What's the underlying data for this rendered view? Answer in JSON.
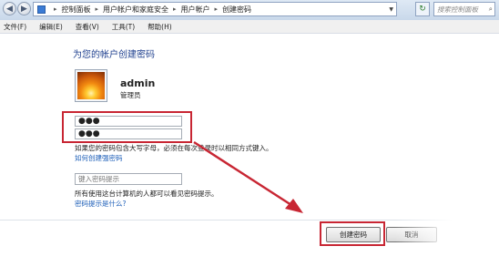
{
  "address_bar": {
    "breadcrumb": [
      "控制面板",
      "用户帐户和家庭安全",
      "用户帐户",
      "创建密码"
    ],
    "search_placeholder": "搜索控制面板"
  },
  "menu": [
    "文件(F)",
    "编辑(E)",
    "查看(V)",
    "工具(T)",
    "帮助(H)"
  ],
  "page": {
    "title": "为您的帐户创建密码",
    "user_name": "admin",
    "user_role": "管理员",
    "new_password_mask": "●●●",
    "confirm_password_mask": "●●●",
    "case_note": "如果您的密码包含大写字母，必须在每次登录时以相同方式键入。",
    "link_strong_password": "如何创建强密码",
    "hint_placeholder": "键入密码提示",
    "hint_note": "所有使用这台计算机的人都可以看见密码提示。",
    "link_hint": "密码提示是什么?"
  },
  "buttons": {
    "create": "创建密码",
    "cancel": "取消"
  },
  "colors": {
    "highlight": "#c82633",
    "link": "#1e5fb8",
    "title": "#1e3f8e"
  }
}
